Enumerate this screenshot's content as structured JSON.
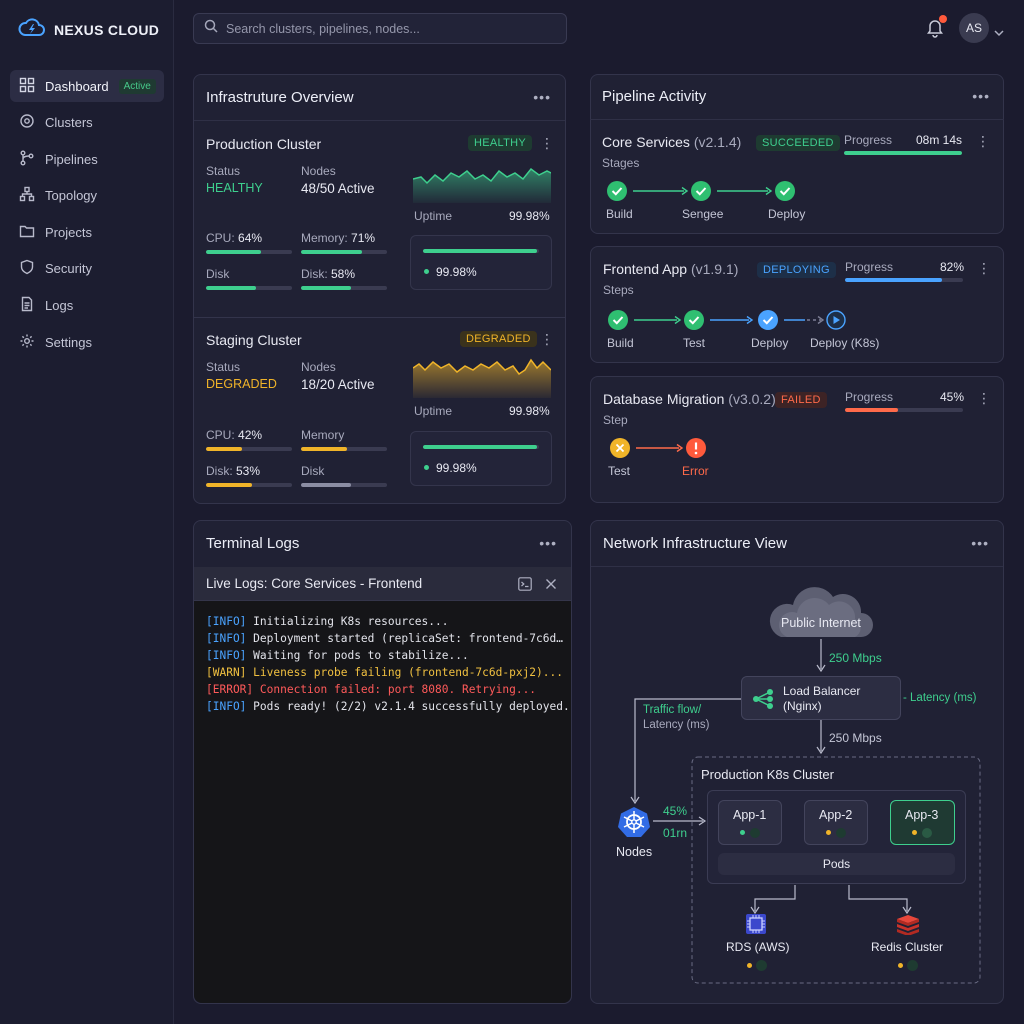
{
  "brand": {
    "name": "NEXUS CLOUD"
  },
  "sidebar": {
    "items": [
      {
        "label": "Dashboard",
        "icon": "grid-icon",
        "badge": "Active"
      },
      {
        "label": "Clusters",
        "icon": "cluster-icon"
      },
      {
        "label": "Pipelines",
        "icon": "pipeline-icon"
      },
      {
        "label": "Topology",
        "icon": "topology-icon"
      },
      {
        "label": "Projects",
        "icon": "folder-icon"
      },
      {
        "label": "Security",
        "icon": "shield-icon"
      },
      {
        "label": "Logs",
        "icon": "file-icon"
      },
      {
        "label": "Settings",
        "icon": "gear-icon"
      }
    ]
  },
  "topbar": {
    "search_placeholder": "Search clusters, pipelines, nodes...",
    "avatar": "AS",
    "colors": {
      "notification_dot": "#ff5a3c"
    }
  },
  "infra": {
    "title": "Infrastruture Overview",
    "production": {
      "name": "Production Cluster",
      "badge": "HEALTHY",
      "status_label": "Status",
      "status_value": "HEALTHY",
      "nodes_label": "Nodes",
      "nodes_value": "48/50 Active",
      "uptime_label": "Uptime",
      "uptime_value": "99.98%",
      "cpu_label": "CPU: ",
      "cpu_value": "64%",
      "cpu_pct": 64,
      "memory_label": "Memory: ",
      "memory_value": "71%",
      "memory_pct": 71,
      "disk_label": "Disk",
      "disk_pct": 58,
      "disk2_label": "Disk: ",
      "disk2_value": "58%",
      "disk2_pct": 58,
      "mini_value": "99.98%",
      "mini_pct": 98
    },
    "staging": {
      "name": "Staging Cluster",
      "badge": "DEGRADED",
      "status_label": "Status",
      "status_value": "DEGRADED",
      "nodes_label": "Nodes",
      "nodes_value": "18/20 Active",
      "uptime_label": "Uptime",
      "uptime_value": "99.98%",
      "cpu_label": "CPU: ",
      "cpu_value": "42%",
      "cpu_pct": 42,
      "memory_label": "Memory",
      "memory_pct": 53,
      "disk_label": "Disk: ",
      "disk_value": "53%",
      "disk_pct": 53,
      "disk2_label": "Disk",
      "disk2_pct": 58,
      "mini_value": "99.98%",
      "mini_pct": 98
    }
  },
  "pipelines": {
    "title": "Pipeline Activity",
    "progress_label": "Progress",
    "items": [
      {
        "name": "Core Services",
        "version": "(v2.1.4)",
        "badge": "SUCCEEDED",
        "sub_label": "Stages",
        "progress_value": "08m 14s",
        "progress_pct": 100,
        "stages": [
          "Build",
          "Sengee",
          "Deploy"
        ]
      },
      {
        "name": "Frontend App",
        "version": "(v1.9.1)",
        "badge": "DEPLOYING",
        "sub_label": "Steps",
        "progress_value": "82%",
        "progress_pct": 82,
        "stages": [
          "Build",
          "Test",
          "Deploy",
          "Deploy (K8s)"
        ]
      },
      {
        "name": "Database Migration",
        "version": "(v3.0.2)",
        "badge": "FAILED",
        "sub_label": "Step",
        "progress_value": "45%",
        "progress_pct": 45,
        "stages": [
          "Test",
          "Error"
        ]
      }
    ]
  },
  "terminal": {
    "title": "Terminal Logs",
    "header": "Live Logs: Core Services - Frontend",
    "lines": [
      {
        "tag": "[INFO]",
        "text": " Initializing K8s resources...",
        "level": "info"
      },
      {
        "tag": "[INFO]",
        "text": " Deployment started (replicaSet: frontend-7c6d…",
        "level": "info"
      },
      {
        "tag": "[INFO]",
        "text": " Waiting for pods to stabilize...",
        "level": "info"
      },
      {
        "tag": "[WARN]",
        "text": " Liveness probe failing (frontend-7c6d-pxj2)...",
        "level": "warn"
      },
      {
        "tag": "[ERROR]",
        "text": " Connection failed: port 8080. Retrying...",
        "level": "error"
      },
      {
        "tag": "[INFO]",
        "text": " Pods ready! (2/2) v2.1.4 successfully deployed.",
        "level": "info"
      }
    ]
  },
  "network": {
    "title": "Network Infrastructure View",
    "internet": "Public Internet",
    "bw1": "250 Mbps",
    "lb_line1": "Load Balancer",
    "lb_line2": "(Nginx)",
    "lb_latency": "- Latency (ms)",
    "traffic_line1": "Traffic flow/",
    "traffic_line2": "Latency (ms)",
    "bw2": "250 Mbps",
    "cluster_title": "Production K8s Cluster",
    "nodes_label": "Nodes",
    "nodes_pct": "45%",
    "nodes_ms": "01rn",
    "apps": [
      "App-1",
      "App-2",
      "App-3"
    ],
    "pods": "Pods",
    "rds": "RDS (AWS)",
    "redis": "Redis Cluster"
  }
}
